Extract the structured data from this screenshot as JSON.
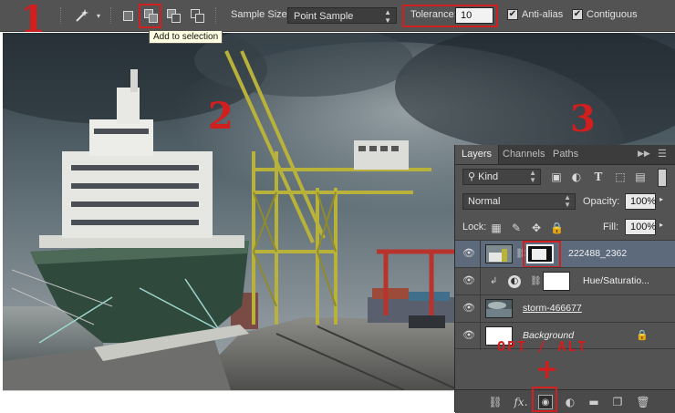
{
  "options_bar": {
    "sample_size_label": "Sample Size:",
    "sample_size_value": "Point Sample",
    "tolerance_label": "Tolerance:",
    "tolerance_value": "10",
    "anti_alias_label": "Anti-alias",
    "anti_alias_checked": true,
    "contiguous_label": "Contiguous",
    "contiguous_checked": true,
    "tool_icon": "magic-wand-icon",
    "tooltip": "Add to selection"
  },
  "annotations": {
    "step1": "1",
    "step2": "2",
    "step3": "3",
    "modifier_hint": "OPT / ALT",
    "plus": "+",
    "accent_color": "#d11e1e"
  },
  "layers_panel": {
    "tabs": [
      "Layers",
      "Channels",
      "Paths"
    ],
    "active_tab": "Layers",
    "filter_label": "Kind",
    "blend_mode": "Normal",
    "opacity_label": "Opacity:",
    "opacity_value": "100%",
    "lock_label": "Lock:",
    "fill_label": "Fill:",
    "fill_value": "100%",
    "layers": [
      {
        "name": "222488_2362",
        "selected": true,
        "visible": true
      },
      {
        "name": "Hue/Saturatio...",
        "selected": false,
        "visible": true
      },
      {
        "name": "storm-466677",
        "selected": false,
        "visible": true
      },
      {
        "name": "Background",
        "selected": false,
        "visible": true,
        "locked": true
      }
    ],
    "bottom_icons": [
      "link-icon",
      "fx-icon",
      "add-mask-icon",
      "adjustment-icon",
      "folder-icon",
      "new-layer-icon",
      "trash-icon"
    ]
  }
}
